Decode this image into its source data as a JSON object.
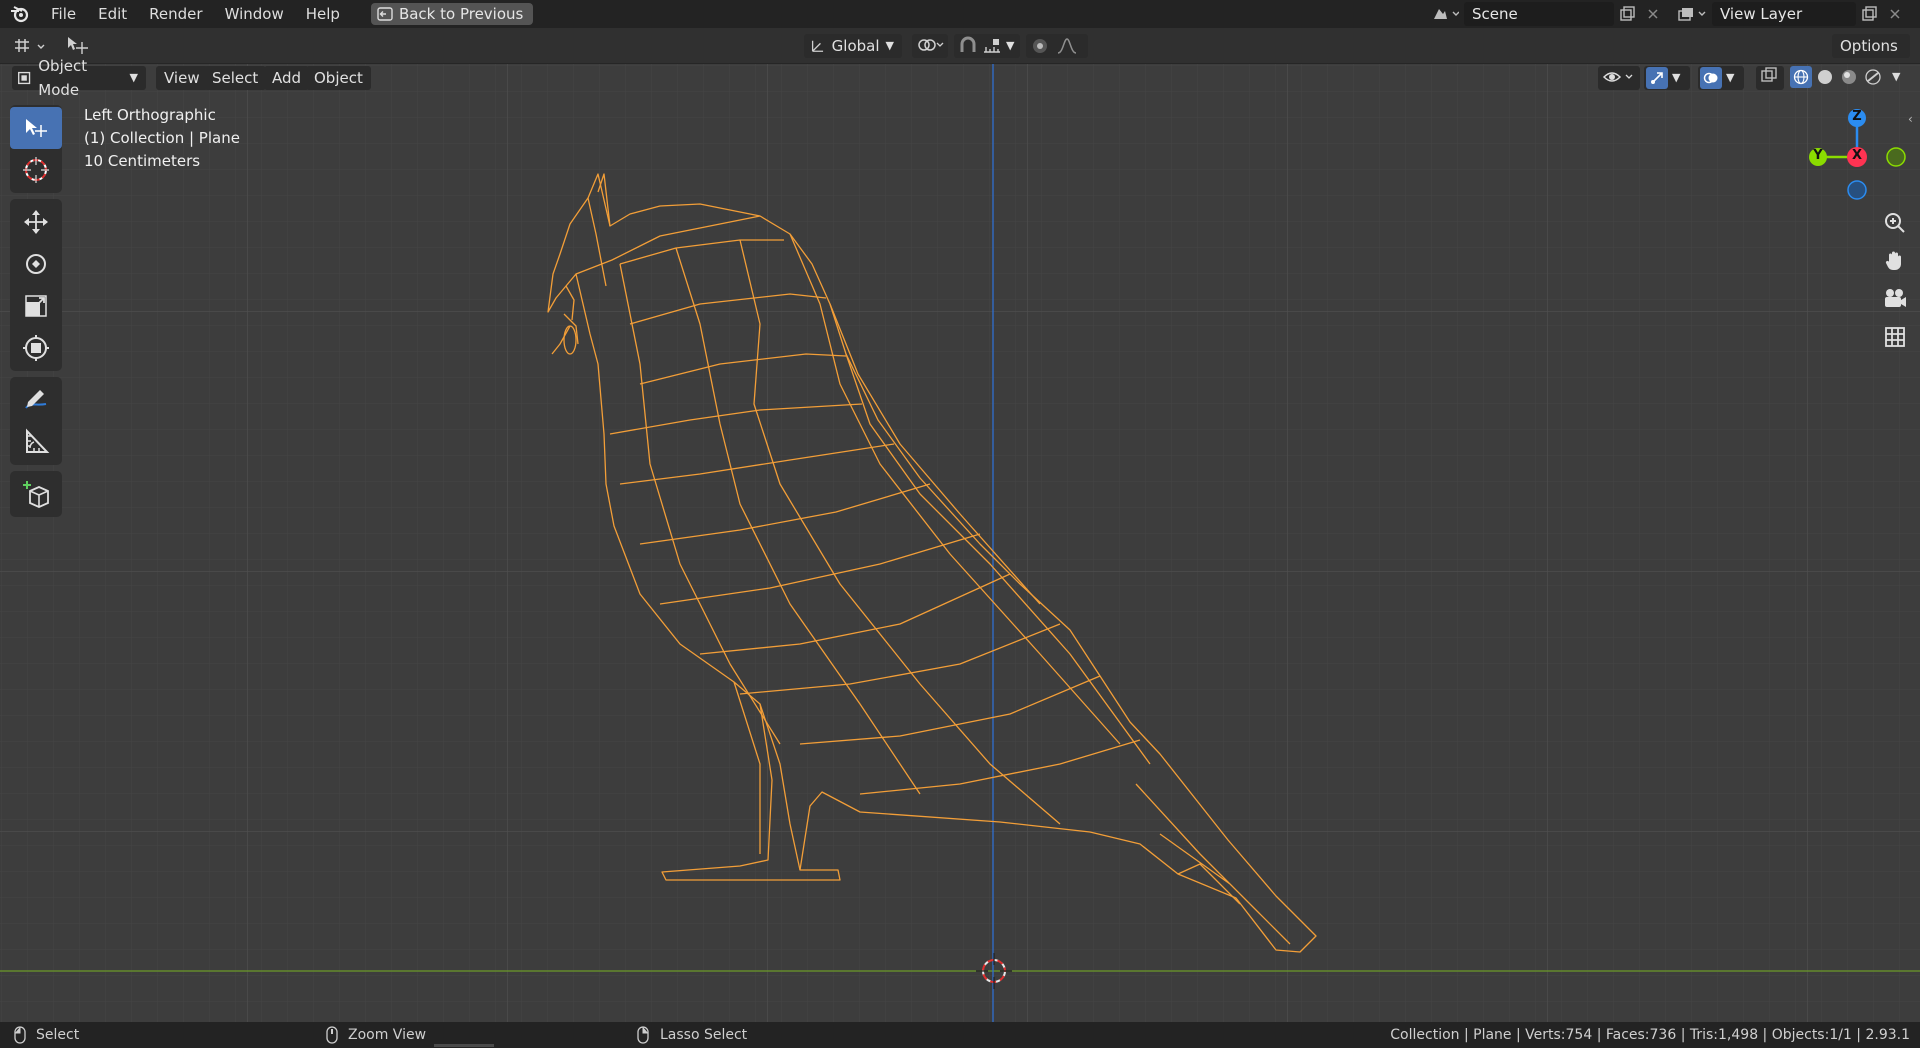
{
  "topbar": {
    "menu": [
      "File",
      "Edit",
      "Render",
      "Window",
      "Help"
    ],
    "back_button": "Back to Previous",
    "scene_name": "Scene",
    "view_layer_name": "View Layer"
  },
  "tool_header": {
    "transform_orientation": "Global",
    "options_label": "Options"
  },
  "viewport_header": {
    "mode": "Object Mode",
    "menus": [
      "View",
      "Select",
      "Add",
      "Object"
    ]
  },
  "viewport": {
    "view_name": "Left Orthographic",
    "collection_info": "(1) Collection | Plane",
    "grid_scale": "10 Centimeters"
  },
  "gizmo": {
    "z_label": "Z",
    "y_label": "Y",
    "x_label": "X"
  },
  "statusbar": {
    "left_action": "Select",
    "middle_action": "Zoom View",
    "right_action": "Lasso Select",
    "stats": "Collection | Plane | Verts:754 | Faces:736 | Tris:1,498 | Objects:1/1 | 2.93.1"
  },
  "colors": {
    "accent": "#4772b3",
    "selection_outline": "#f29e38",
    "x_axis": "#ff3352",
    "y_axis": "#8bdc00",
    "z_axis": "#2b8cf0",
    "viewport_bg": "#3d3d3d"
  },
  "icons": [
    "blender-logo",
    "back-icon",
    "scene-icon",
    "view-layer-icon",
    "select-box-icon",
    "cursor-icon",
    "move-icon",
    "rotate-icon",
    "scale-icon",
    "transform-icon",
    "annotate-icon",
    "measure-icon",
    "add-cube-icon",
    "zoom-icon",
    "hand-icon",
    "camera-icon",
    "grid-icon"
  ]
}
